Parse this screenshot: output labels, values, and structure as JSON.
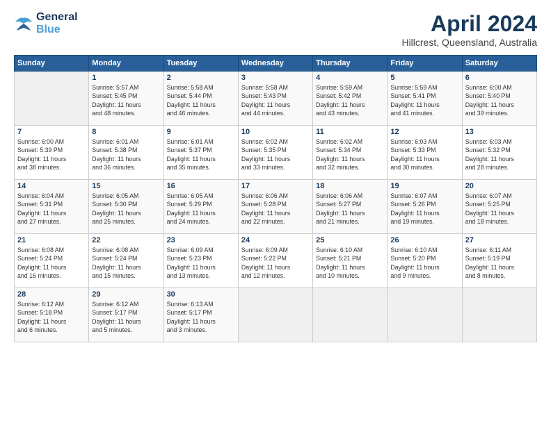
{
  "header": {
    "logo_line1": "General",
    "logo_line2": "Blue",
    "month": "April 2024",
    "location": "Hillcrest, Queensland, Australia"
  },
  "weekdays": [
    "Sunday",
    "Monday",
    "Tuesday",
    "Wednesday",
    "Thursday",
    "Friday",
    "Saturday"
  ],
  "weeks": [
    [
      {
        "day": "",
        "info": ""
      },
      {
        "day": "1",
        "info": "Sunrise: 5:57 AM\nSunset: 5:45 PM\nDaylight: 11 hours\nand 48 minutes."
      },
      {
        "day": "2",
        "info": "Sunrise: 5:58 AM\nSunset: 5:44 PM\nDaylight: 11 hours\nand 46 minutes."
      },
      {
        "day": "3",
        "info": "Sunrise: 5:58 AM\nSunset: 5:43 PM\nDaylight: 11 hours\nand 44 minutes."
      },
      {
        "day": "4",
        "info": "Sunrise: 5:59 AM\nSunset: 5:42 PM\nDaylight: 11 hours\nand 43 minutes."
      },
      {
        "day": "5",
        "info": "Sunrise: 5:59 AM\nSunset: 5:41 PM\nDaylight: 11 hours\nand 41 minutes."
      },
      {
        "day": "6",
        "info": "Sunrise: 6:00 AM\nSunset: 5:40 PM\nDaylight: 11 hours\nand 39 minutes."
      }
    ],
    [
      {
        "day": "7",
        "info": "Sunrise: 6:00 AM\nSunset: 5:39 PM\nDaylight: 11 hours\nand 38 minutes."
      },
      {
        "day": "8",
        "info": "Sunrise: 6:01 AM\nSunset: 5:38 PM\nDaylight: 11 hours\nand 36 minutes."
      },
      {
        "day": "9",
        "info": "Sunrise: 6:01 AM\nSunset: 5:37 PM\nDaylight: 11 hours\nand 35 minutes."
      },
      {
        "day": "10",
        "info": "Sunrise: 6:02 AM\nSunset: 5:35 PM\nDaylight: 11 hours\nand 33 minutes."
      },
      {
        "day": "11",
        "info": "Sunrise: 6:02 AM\nSunset: 5:34 PM\nDaylight: 11 hours\nand 32 minutes."
      },
      {
        "day": "12",
        "info": "Sunrise: 6:03 AM\nSunset: 5:33 PM\nDaylight: 11 hours\nand 30 minutes."
      },
      {
        "day": "13",
        "info": "Sunrise: 6:03 AM\nSunset: 5:32 PM\nDaylight: 11 hours\nand 28 minutes."
      }
    ],
    [
      {
        "day": "14",
        "info": "Sunrise: 6:04 AM\nSunset: 5:31 PM\nDaylight: 11 hours\nand 27 minutes."
      },
      {
        "day": "15",
        "info": "Sunrise: 6:05 AM\nSunset: 5:30 PM\nDaylight: 11 hours\nand 25 minutes."
      },
      {
        "day": "16",
        "info": "Sunrise: 6:05 AM\nSunset: 5:29 PM\nDaylight: 11 hours\nand 24 minutes."
      },
      {
        "day": "17",
        "info": "Sunrise: 6:06 AM\nSunset: 5:28 PM\nDaylight: 11 hours\nand 22 minutes."
      },
      {
        "day": "18",
        "info": "Sunrise: 6:06 AM\nSunset: 5:27 PM\nDaylight: 11 hours\nand 21 minutes."
      },
      {
        "day": "19",
        "info": "Sunrise: 6:07 AM\nSunset: 5:26 PM\nDaylight: 11 hours\nand 19 minutes."
      },
      {
        "day": "20",
        "info": "Sunrise: 6:07 AM\nSunset: 5:25 PM\nDaylight: 11 hours\nand 18 minutes."
      }
    ],
    [
      {
        "day": "21",
        "info": "Sunrise: 6:08 AM\nSunset: 5:24 PM\nDaylight: 11 hours\nand 16 minutes."
      },
      {
        "day": "22",
        "info": "Sunrise: 6:08 AM\nSunset: 5:24 PM\nDaylight: 11 hours\nand 15 minutes."
      },
      {
        "day": "23",
        "info": "Sunrise: 6:09 AM\nSunset: 5:23 PM\nDaylight: 11 hours\nand 13 minutes."
      },
      {
        "day": "24",
        "info": "Sunrise: 6:09 AM\nSunset: 5:22 PM\nDaylight: 11 hours\nand 12 minutes."
      },
      {
        "day": "25",
        "info": "Sunrise: 6:10 AM\nSunset: 5:21 PM\nDaylight: 11 hours\nand 10 minutes."
      },
      {
        "day": "26",
        "info": "Sunrise: 6:10 AM\nSunset: 5:20 PM\nDaylight: 11 hours\nand 9 minutes."
      },
      {
        "day": "27",
        "info": "Sunrise: 6:11 AM\nSunset: 5:19 PM\nDaylight: 11 hours\nand 8 minutes."
      }
    ],
    [
      {
        "day": "28",
        "info": "Sunrise: 6:12 AM\nSunset: 5:18 PM\nDaylight: 11 hours\nand 6 minutes."
      },
      {
        "day": "29",
        "info": "Sunrise: 6:12 AM\nSunset: 5:17 PM\nDaylight: 11 hours\nand 5 minutes."
      },
      {
        "day": "30",
        "info": "Sunrise: 6:13 AM\nSunset: 5:17 PM\nDaylight: 11 hours\nand 3 minutes."
      },
      {
        "day": "",
        "info": ""
      },
      {
        "day": "",
        "info": ""
      },
      {
        "day": "",
        "info": ""
      },
      {
        "day": "",
        "info": ""
      }
    ]
  ]
}
